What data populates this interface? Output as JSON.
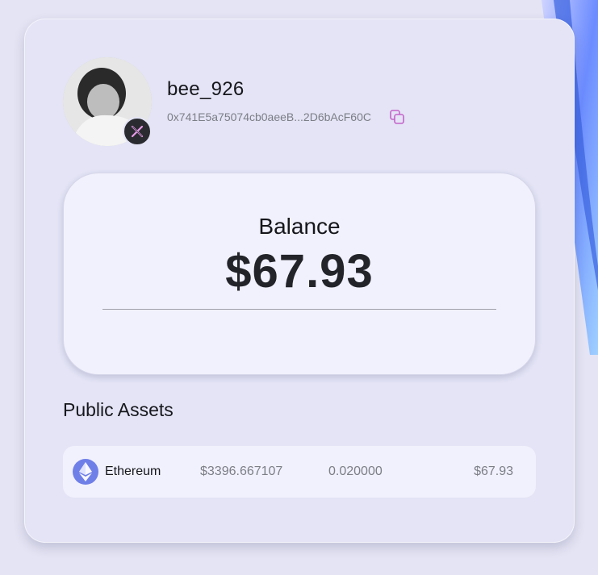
{
  "profile": {
    "username": "bee_926",
    "address": "0x741E5a75074cb0aeeB...2D6bAcF60C",
    "social_icon": "x-logo-icon",
    "copy_icon": "copy-icon"
  },
  "balance": {
    "label": "Balance",
    "value": "$67.93"
  },
  "assets": {
    "title": "Public Assets",
    "rows": [
      {
        "icon": "ethereum-icon",
        "name": "Ethereum",
        "price": "$3396.667107",
        "amount": "0.020000",
        "value": "$67.93"
      }
    ]
  },
  "colors": {
    "accent": "#c463c8",
    "ethereum": "#6f7fe8",
    "background": "#e4e4f4"
  }
}
